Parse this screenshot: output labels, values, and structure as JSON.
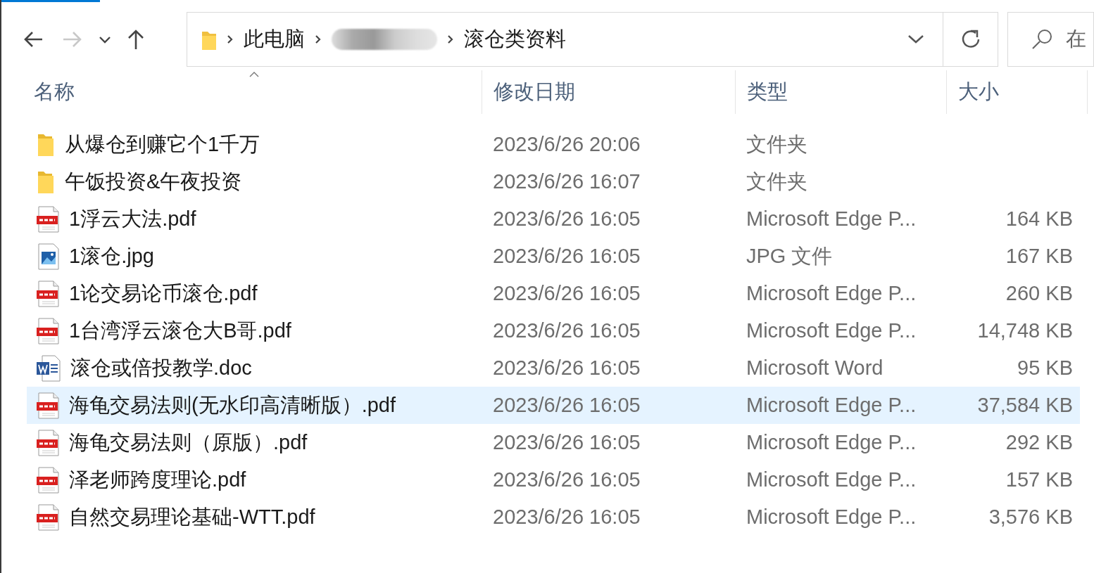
{
  "nav": [
    {
      "kind": "back",
      "disabled": false
    },
    {
      "kind": "forward",
      "disabled": true
    },
    {
      "kind": "recent",
      "disabled": false
    },
    {
      "kind": "up",
      "disabled": false
    }
  ],
  "address": {
    "crumbs": [
      {
        "kind": "text",
        "label": "此电脑"
      },
      {
        "kind": "hidden"
      },
      {
        "kind": "text",
        "label": "滚仓类资料"
      }
    ]
  },
  "search": {
    "placeholder": "在"
  },
  "columns": [
    {
      "label": "名称",
      "sorted": true
    },
    {
      "label": "修改日期",
      "sorted": false
    },
    {
      "label": "类型",
      "sorted": false
    },
    {
      "label": "大小",
      "sorted": false
    }
  ],
  "files": [
    {
      "kind": "folder",
      "name": "从爆仓到赚它个1千万",
      "date": "2023/6/26 20:06",
      "type": "文件夹",
      "selected": false
    },
    {
      "kind": "folder",
      "name": "午饭投资&午夜投资",
      "date": "2023/6/26 16:07",
      "type": "文件夹",
      "selected": false
    },
    {
      "kind": "pdf",
      "name": "1浮云大法.pdf",
      "date": "2023/6/26 16:05",
      "type": "Microsoft Edge P...",
      "size": "164 KB",
      "selected": false
    },
    {
      "kind": "jpg",
      "name": "1滚仓.jpg",
      "date": "2023/6/26 16:05",
      "type": "JPG 文件",
      "size": "167 KB",
      "selected": false
    },
    {
      "kind": "pdf",
      "name": "1论交易论币滚仓.pdf",
      "date": "2023/6/26 16:05",
      "type": "Microsoft Edge P...",
      "size": "260 KB",
      "selected": false
    },
    {
      "kind": "pdf",
      "name": "1台湾浮云滚仓大B哥.pdf",
      "date": "2023/6/26 16:05",
      "type": "Microsoft Edge P...",
      "size": "14,748 KB",
      "selected": false
    },
    {
      "kind": "doc",
      "name": "滚仓或倍投教学.doc",
      "date": "2023/6/26 16:05",
      "type": "Microsoft Word",
      "size": "95 KB",
      "selected": false
    },
    {
      "kind": "pdf",
      "name": "海龟交易法则(无水印高清晰版）.pdf",
      "date": "2023/6/26 16:05",
      "type": "Microsoft Edge P...",
      "size": "37,584 KB",
      "selected": true
    },
    {
      "kind": "pdf",
      "name": "海龟交易法则（原版）.pdf",
      "date": "2023/6/26 16:05",
      "type": "Microsoft Edge P...",
      "size": "292 KB",
      "selected": false
    },
    {
      "kind": "pdf",
      "name": "泽老师跨度理论.pdf",
      "date": "2023/6/26 16:05",
      "type": "Microsoft Edge P...",
      "size": "157 KB",
      "selected": false
    },
    {
      "kind": "pdf",
      "name": "自然交易理论基础-WTT.pdf",
      "date": "2023/6/26 16:05",
      "type": "Microsoft Edge P...",
      "size": "3,576 KB",
      "selected": false
    }
  ]
}
